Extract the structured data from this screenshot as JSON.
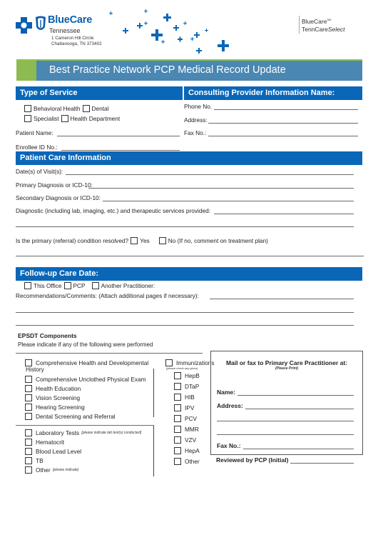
{
  "header": {
    "brand_name": "BlueCare",
    "brand_sub": "Tennessee",
    "address_line1": "1 Cameron Hill Circle",
    "address_line2": "Chattanooga, TN  373402",
    "right_brand_line1": "BlueCare",
    "right_brand_tm": "SM",
    "right_brand_line2_a": "TennCare",
    "right_brand_line2_b": "Select",
    "colors": {
      "brand_blue": "#0a5fb0",
      "accent_green": "#8dbb52",
      "title_bar": "#4a87b2",
      "section_bar": "#0a67b8"
    }
  },
  "title": "Best Practice Network PCP Medical Record Update",
  "type_of_service": {
    "heading": "Type of Service",
    "options": [
      "Behavioral Health",
      "Dental",
      "Specialist",
      "Health Department"
    ],
    "patient_name_label": "Patient Name:",
    "enrollee_id_label": "Enrollee ID No.:"
  },
  "consulting_provider": {
    "heading": "Consulting Provider Information Name:",
    "phone_label": "Phone No.",
    "address_label": "Address:",
    "fax_label": "Fax No.:"
  },
  "patient_care": {
    "heading": "Patient Care Information",
    "date_of_visit_label": "Date(s) of Visit(s):",
    "primary_dx_label": "Primary Diagnosis or ICD-10:",
    "secondary_dx_label": "Secondary Diagnosis or ICD-10:",
    "diagnostic_label": "Diagnostic (including lab, imaging, etc.) and therapeutic services provided:",
    "resolved_question": "Is the primary (referral) condition resolved?",
    "resolved_yes": "Yes",
    "resolved_no": "No (If no, comment on treatment plan)"
  },
  "follow_up": {
    "heading": "Follow-up Care Date:",
    "options": [
      "This Office",
      "PCP",
      "Another Practitioner:"
    ],
    "recommendations_label": "Recommendations/Comments: (Attach additional pages if necessary):"
  },
  "epsdt": {
    "title": "EPSDT Components",
    "subtitle": "Please indicate if any of the following were performed",
    "components": [
      "Comprehensive Health and Developmental",
      "Comprehensive Unclothed Physical Exam",
      "Health Education",
      "Vision Screening",
      "Hearing Screening",
      "Dental Screening and Referral"
    ],
    "components_wrap": "History",
    "lab_label": "Laboratory Tests",
    "lab_note": "[please indicate lab test(s) conducted]",
    "labs": [
      "Hematocrit",
      "Blood Lead Level",
      "TB"
    ],
    "other_label": "Other",
    "other_note": "(please indicate)",
    "immunizations_label": "Immunizations",
    "immunizations_note": "(please check any given)",
    "immunizations": [
      "HepB",
      "DTaP",
      "HIB",
      "IPV",
      "PCV",
      "MMR",
      "VZV",
      "HepA",
      "Other"
    ]
  },
  "mail_box": {
    "heading": "Mail or fax to Primary Care Practitioner at:",
    "note": "(Please Print)",
    "name_label": "Name:",
    "address_label": "Address:",
    "fax_label": "Fax No.:",
    "reviewed_label": "Reviewed by PCP (Initial)"
  }
}
